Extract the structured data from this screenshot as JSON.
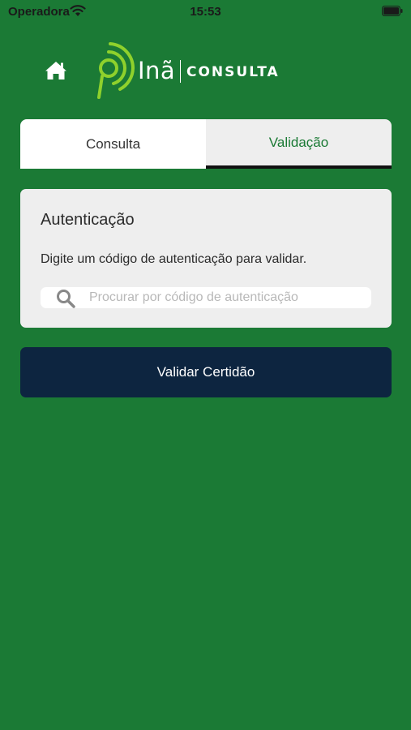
{
  "status_bar": {
    "carrier": "Operadora",
    "time": "15:53"
  },
  "header": {
    "brand_name": "Inã",
    "brand_product": "CONSULTA",
    "home_icon": "home-icon",
    "logo_icon": "ina-logo"
  },
  "tabs": [
    {
      "label": "Consulta",
      "selected": false
    },
    {
      "label": "Validação",
      "selected": true
    }
  ],
  "card": {
    "title": "Autenticação",
    "description": "Digite um código de autenticação para validar.",
    "search_placeholder": "Procurar por código de autenticação",
    "search_value": ""
  },
  "validate_button": {
    "label": "Validar Certidão"
  },
  "colors": {
    "background": "#1b7a35",
    "accent_green": "#1b7a35",
    "button_dark_blue": "#0d2540",
    "logo_lime": "#8fd12c"
  }
}
